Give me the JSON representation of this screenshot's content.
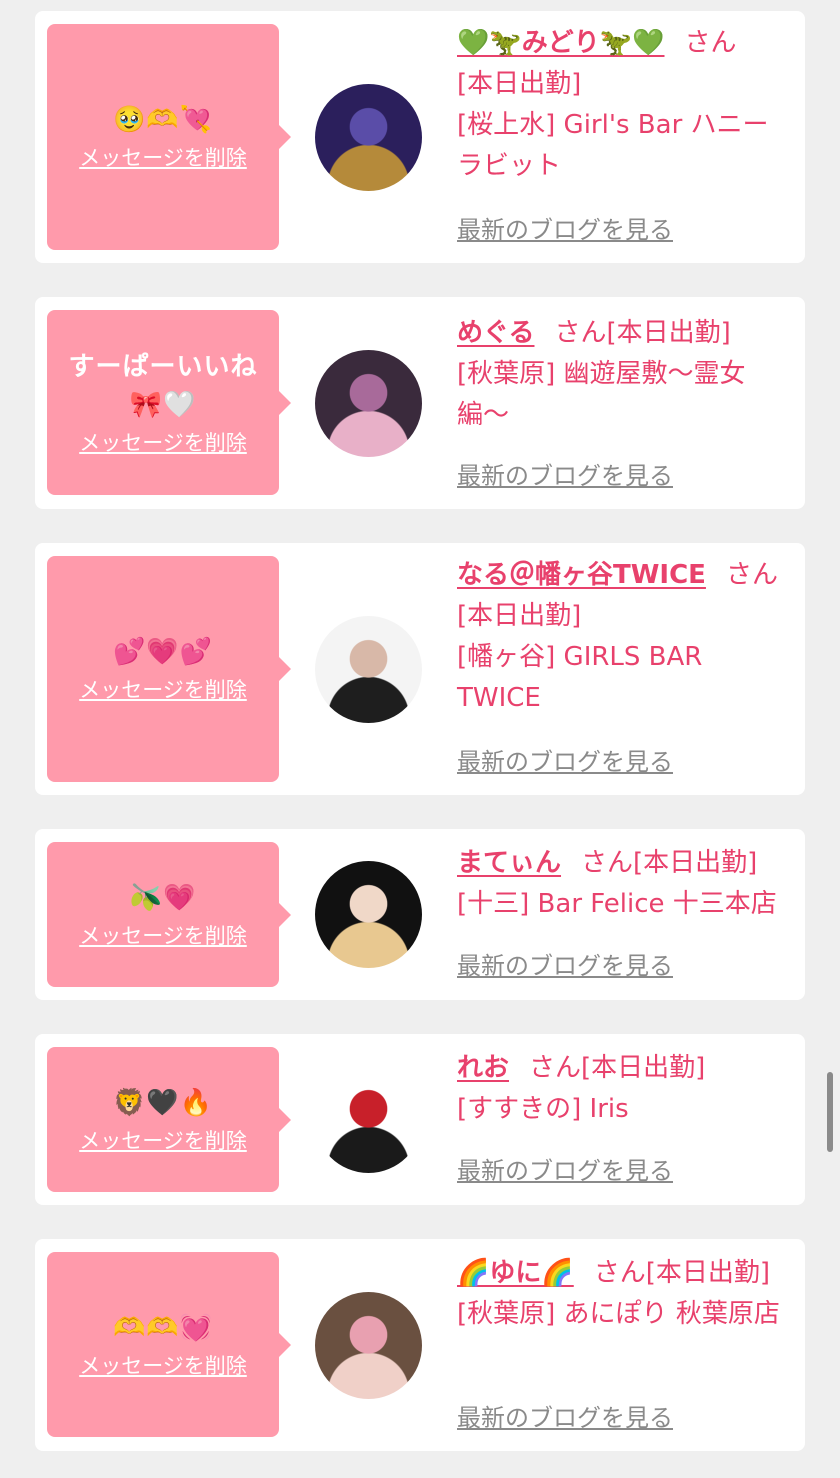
{
  "ui": {
    "delete_label": "メッセージを削除",
    "blog_label": "最新のブログを見る",
    "san": "さん",
    "shift_today": "[本日出勤]"
  },
  "colors": {
    "accent": "#e8416c",
    "bubble": "#ff9aab",
    "link_gray": "#8a8a8a",
    "background": "#efefef"
  },
  "cards": [
    {
      "message": "🥹🫶💘",
      "name": "💚🦖みどり🦖💚",
      "shop": "[桜上水] Girl's Bar ハニーラビット",
      "avatar_colors": [
        "#2b1f5c",
        "#b58a3a",
        "#5a4da8"
      ]
    },
    {
      "message": "すーぱーいいね🎀🤍",
      "name": "めぐる",
      "shop": "[秋葉原] 幽遊屋敷〜霊女編〜",
      "avatar_colors": [
        "#3a2a3c",
        "#e8b0c8",
        "#a86a9a"
      ]
    },
    {
      "message": "💕💗💕",
      "name": "なる＠幡ヶ谷TWICE",
      "shop": "[幡ヶ谷] GIRLS BAR TWICE",
      "avatar_colors": [
        "#f4f4f4",
        "#1e1e1e",
        "#d8b8a8"
      ]
    },
    {
      "message": "🫒💗",
      "name": "まてぃん",
      "shop": "[十三] Bar Felice 十三本店",
      "avatar_colors": [
        "#111111",
        "#e8c890",
        "#f0d8c8"
      ]
    },
    {
      "message": "🦁🖤🔥",
      "name": "れお",
      "shop": "[すすきの] Iris",
      "avatar_colors": [
        "#ffffff",
        "#1a1a1a",
        "#c8202a"
      ]
    },
    {
      "message": "🫶🫶💓",
      "name": "🌈ゆに🌈",
      "shop": "[秋葉原] あにぽり 秋葉原店",
      "avatar_colors": [
        "#6a5040",
        "#f0d0c8",
        "#e8a0b0"
      ]
    }
  ]
}
